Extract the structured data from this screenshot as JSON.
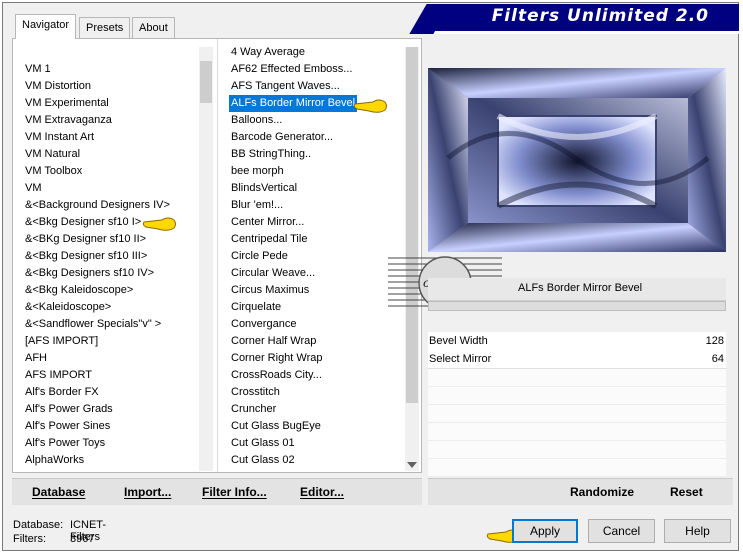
{
  "window": {
    "title": "Filters Unlimited 2.0"
  },
  "tabs": [
    {
      "label": "Navigator",
      "active": true
    },
    {
      "label": "Presets",
      "active": false
    },
    {
      "label": "About",
      "active": false
    }
  ],
  "categories": [
    "VM 1",
    "VM Distortion",
    "VM Experimental",
    "VM Extravaganza",
    "VM Instant Art",
    "VM Natural",
    "VM Toolbox",
    "VM",
    "&<Background Designers IV>",
    "&<Bkg Designer sf10 I>",
    "&<BKg Designer sf10 II>",
    "&<Bkg Designer sf10 III>",
    "&<Bkg Designers sf10 IV>",
    "&<Bkg Kaleidoscope>",
    "&<Kaleidoscope>",
    "&<Sandflower Specials\"v\" >",
    "[AFS IMPORT]",
    "AFH",
    "AFS IMPORT",
    "Alf's Border FX",
    "Alf's Power Grads",
    "Alf's Power Sines",
    "Alf's Power Toys",
    "AlphaWorks"
  ],
  "filters": [
    "4 Way Average",
    "AF62 Effected Emboss...",
    "AFS Tangent Waves...",
    "ALFs Border Mirror Bevel",
    "Balloons...",
    "Barcode Generator...",
    "BB StringThing..",
    "bee morph",
    "BlindsVertical",
    "Blur 'em!...",
    "Center Mirror...",
    "Centripedal Tile",
    "Circle Pede",
    "Circular Weave...",
    "Circus Maximus",
    "Cirquelate",
    "Convergance",
    "Corner Half Wrap",
    "Corner Right Wrap",
    "CrossRoads City...",
    "Crosstitch",
    "Cruncher",
    "Cut Glass  BugEye",
    "Cut Glass 01",
    "Cut Glass 02"
  ],
  "selected_filter_index": 3,
  "pointer_category_index": 9,
  "left_buttons": {
    "database": "Database",
    "import": "Import...",
    "filter_info": "Filter Info...",
    "editor": "Editor..."
  },
  "right_buttons": {
    "randomize": "Randomize",
    "reset": "Reset"
  },
  "filter_name": "ALFs Border Mirror Bevel",
  "params": [
    {
      "label": "Bevel Width",
      "value": "128"
    },
    {
      "label": "Select Mirror",
      "value": "64"
    }
  ],
  "watermark_text": "claudia",
  "status": {
    "database_label": "Database:",
    "database_value": "ICNET-Filters",
    "filters_label": "Filters:",
    "filters_value": "3967"
  },
  "dialog_buttons": {
    "apply": "Apply",
    "cancel": "Cancel",
    "help": "Help"
  },
  "colors": {
    "title_bg": "#000080",
    "selection": "#0078d7",
    "preview_base": "#8a98d0",
    "pointer": "#ffd800"
  }
}
